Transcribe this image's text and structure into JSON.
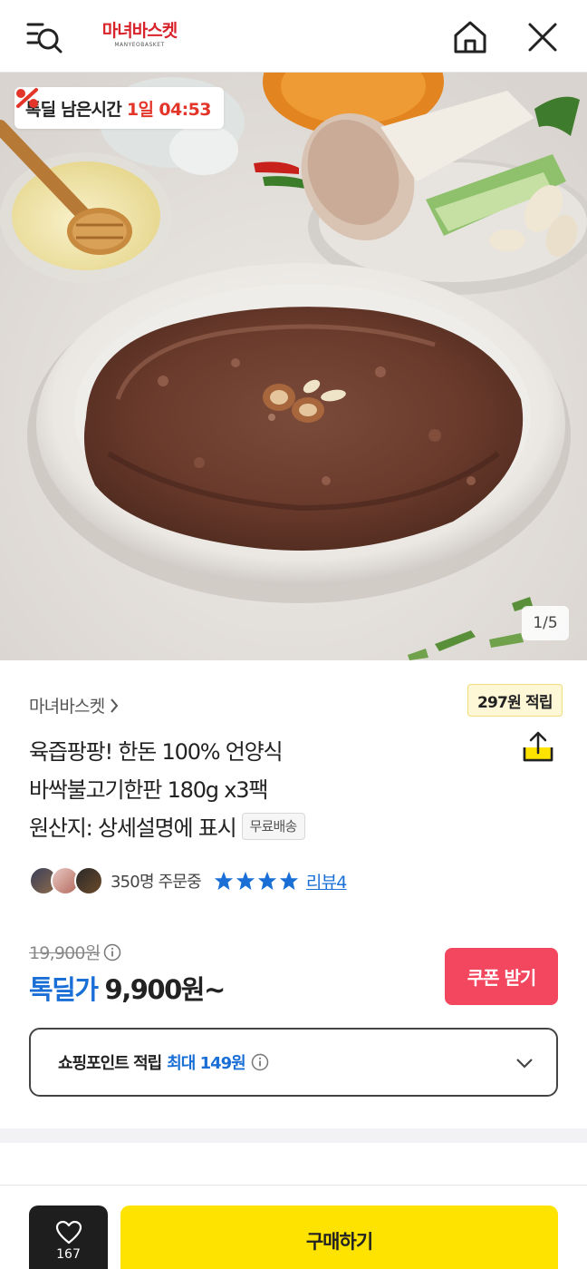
{
  "header": {
    "logo_text": "마녀바스켓",
    "logo_subtext": "MANYEOBASKET",
    "icons": [
      "search-menu-icon",
      "home-icon",
      "close-icon"
    ]
  },
  "hero": {
    "timer_label": "톡딜 남은시간",
    "timer_value": "1일 04:53",
    "page_indicator": "1/5"
  },
  "product": {
    "seller": "마녀바스켓",
    "points_tip": "297원 적립",
    "title_lines": [
      "육즙팡팡! 한돈 100% 언양식",
      "바싹불고기한판 180g x3팩",
      "원산지: 상세설명에 표시"
    ],
    "free_shipping": "무료배송",
    "orders": "350명 주문중",
    "rating_stars": 4,
    "review_label": "리뷰",
    "review_count": "4"
  },
  "price": {
    "original": "19,900원",
    "deal_label": "톡딜가",
    "deal_value": "9,900원~",
    "coupon_button": "쿠폰 받기"
  },
  "points_box": {
    "label": "쇼핑포인트 적립",
    "max": "최대 149원"
  },
  "bottom": {
    "like_count": "167",
    "buy_button": "구매하기"
  },
  "colors": {
    "accent_blue": "#1a6fd6",
    "deal_red": "#e33529",
    "coupon_pink": "#f2475e",
    "buy_yellow": "#ffe300"
  }
}
